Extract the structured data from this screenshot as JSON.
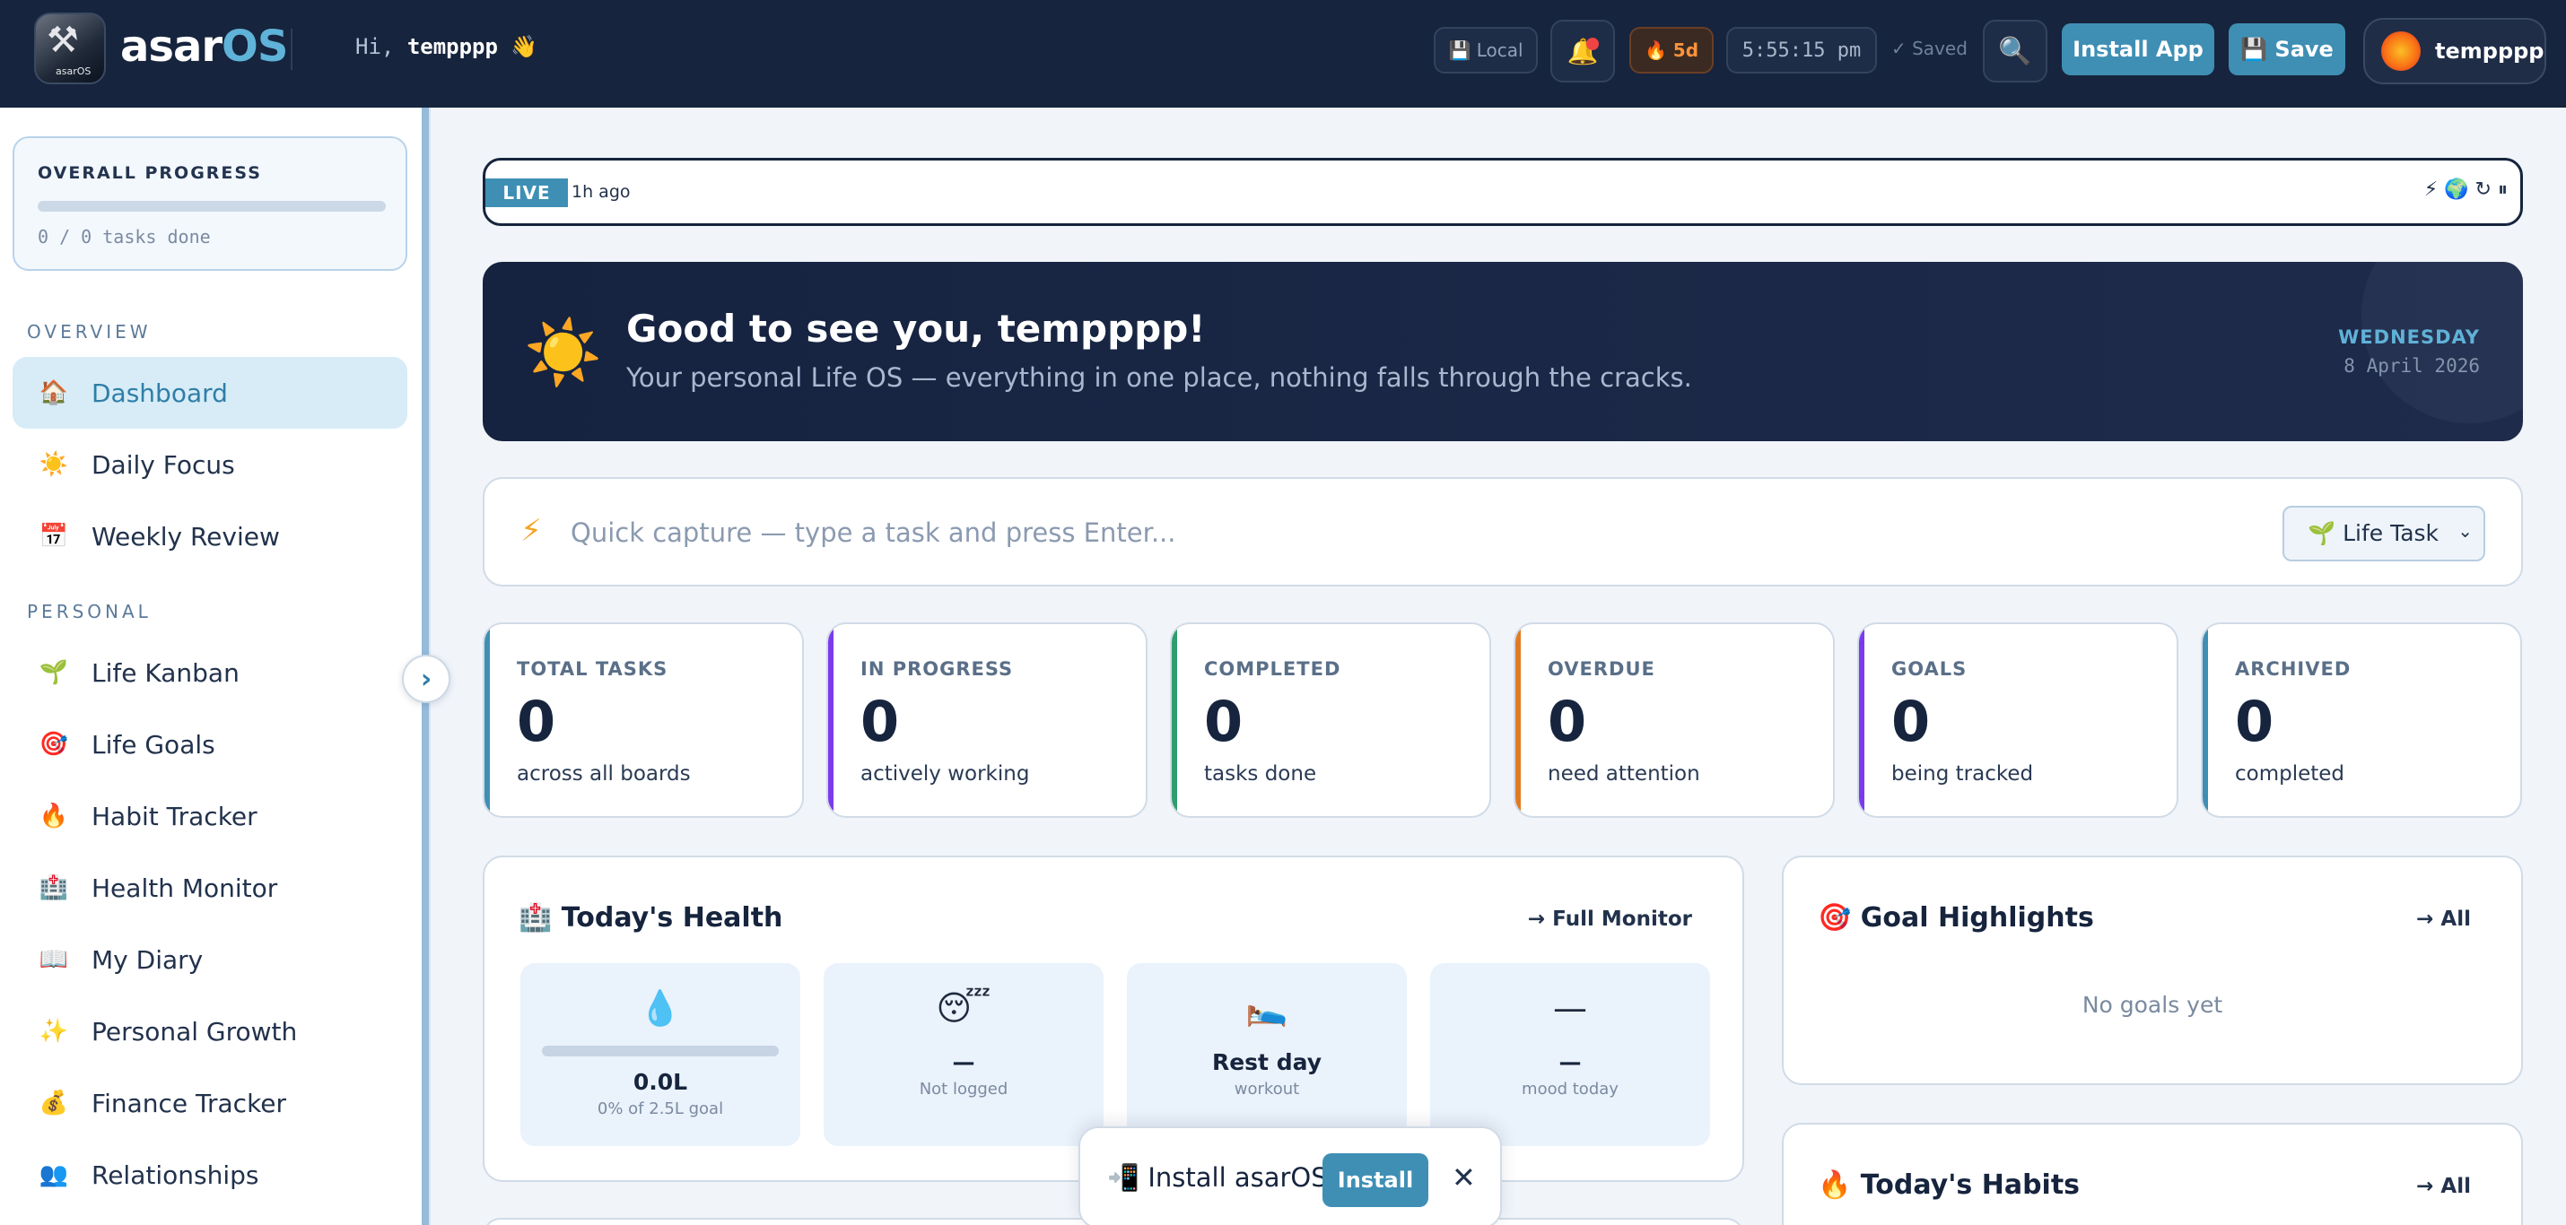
{
  "header": {
    "logo_mini": "asarOS",
    "brand_main": "asar",
    "brand_accent": "OS",
    "greeting_prefix": "Hi,",
    "username": "tempppp",
    "wave": "👋",
    "storage_label": "💾 Local",
    "notification_icon": "🔔",
    "streak_label": "🔥 5d",
    "clock": "5:55:15 pm",
    "saved_label": "✓ Saved",
    "search_icon": "🔍",
    "install_app_label": "Install App",
    "save_label": "💾 Save",
    "user_name": "tempppp"
  },
  "sidebar": {
    "progress_title": "OVERALL PROGRESS",
    "progress_value": 0,
    "progress_text": "0 / 0 tasks done",
    "sections": [
      {
        "title": "OVERVIEW",
        "items": [
          {
            "icon": "🏠",
            "label": "Dashboard",
            "active": true
          },
          {
            "icon": "☀️",
            "label": "Daily Focus"
          },
          {
            "icon": "📅",
            "label": "Weekly Review"
          }
        ]
      },
      {
        "title": "PERSONAL",
        "items": [
          {
            "icon": "🌱",
            "label": "Life Kanban"
          },
          {
            "icon": "🎯",
            "label": "Life Goals"
          },
          {
            "icon": "🔥",
            "label": "Habit Tracker"
          },
          {
            "icon": "🏥",
            "label": "Health Monitor"
          },
          {
            "icon": "📖",
            "label": "My Diary"
          },
          {
            "icon": "✨",
            "label": "Personal Growth"
          },
          {
            "icon": "💰",
            "label": "Finance Tracker"
          },
          {
            "icon": "👥",
            "label": "Relationships"
          }
        ]
      }
    ],
    "collapse_icon": "›"
  },
  "live": {
    "tag": "LIVE",
    "ago": "1h ago",
    "icons": "⚡ 🌍 ↻ ⏸"
  },
  "hero": {
    "icon": "☀️",
    "title": "Good to see you, tempppp!",
    "subtitle": "Your personal Life OS — everything in one place, nothing falls through the cracks.",
    "weekday": "WEDNESDAY",
    "date": "8 April 2026"
  },
  "capture": {
    "icon": "⚡",
    "placeholder": "Quick capture — type a task and press Enter...",
    "value": "",
    "select_value": "🌱 Life Task",
    "select_arrow": "⌄"
  },
  "stats": [
    {
      "label": "TOTAL TASKS",
      "value": "0",
      "caption": "across all boards",
      "color": "#3f8fb4"
    },
    {
      "label": "IN PROGRESS",
      "value": "0",
      "caption": "actively working",
      "color": "#7c3aed"
    },
    {
      "label": "COMPLETED",
      "value": "0",
      "caption": "tasks done",
      "color": "#2f9e6e"
    },
    {
      "label": "OVERDUE",
      "value": "0",
      "caption": "need attention",
      "color": "#e07b24"
    },
    {
      "label": "GOALS",
      "value": "0",
      "caption": "being tracked",
      "color": "#7c3aed"
    },
    {
      "label": "ARCHIVED",
      "value": "0",
      "caption": "completed",
      "color": "#3f8fb4"
    }
  ],
  "health": {
    "title": "🏥 Today's Health",
    "link": "→ Full Monitor",
    "water": {
      "icon": "💧",
      "value": "0.0L",
      "sub": "0% of 2.5L goal",
      "progress": 0
    },
    "sleep": {
      "icon": "😴",
      "value": "—",
      "sub": "Not logged"
    },
    "workout": {
      "icon": "🛌",
      "value": "Rest day",
      "sub": "workout"
    },
    "mood": {
      "icon": "—",
      "value": "—",
      "sub": "mood today"
    }
  },
  "goals": {
    "title": "🎯 Goal Highlights",
    "link": "→ All",
    "empty": "No goals yet"
  },
  "habits": {
    "title": "🔥 Today's Habits",
    "link": "→ All"
  },
  "install_popup": {
    "label": "📲 Install asarOS",
    "button": "Install",
    "close": "✕"
  }
}
